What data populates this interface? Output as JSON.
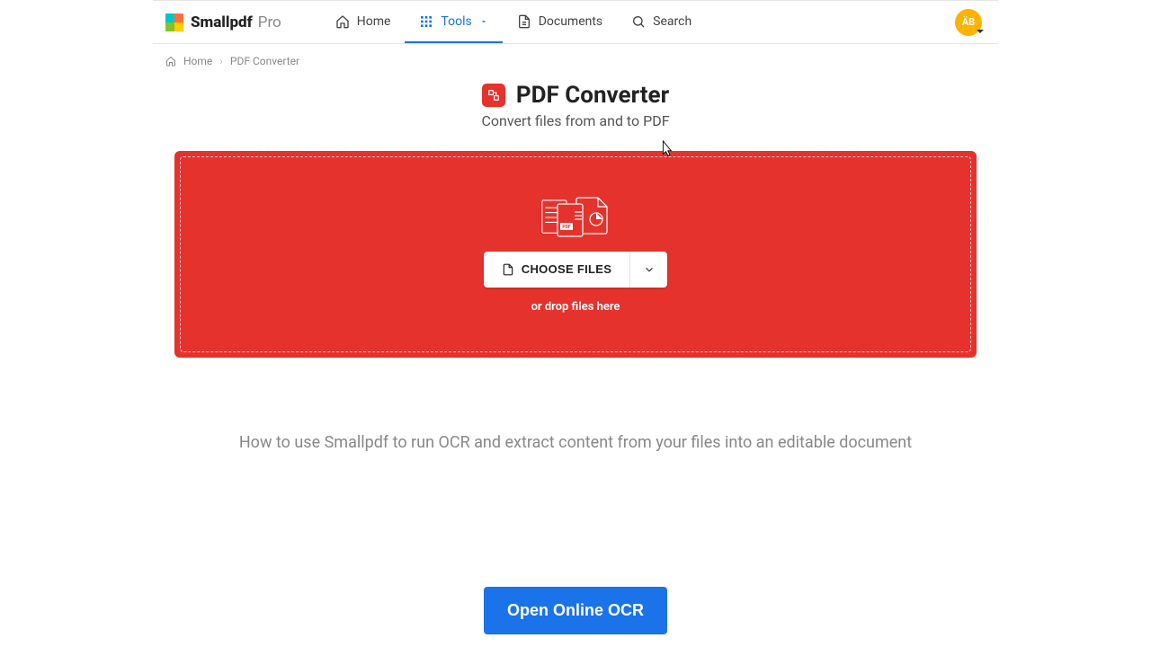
{
  "brand": {
    "name": "Smallpdf",
    "tier": "Pro"
  },
  "nav": {
    "home": "Home",
    "tools": "Tools",
    "documents": "Documents",
    "search": "Search"
  },
  "avatar": {
    "initials": "ÄB"
  },
  "breadcrumb": {
    "home": "Home",
    "current": "PDF Converter"
  },
  "page": {
    "title": "PDF Converter",
    "subtitle": "Convert files from and to PDF"
  },
  "dropzone": {
    "choose_label": "CHOOSE FILES",
    "hint": "or drop files here"
  },
  "howto": "How to use Smallpdf to run OCR and extract content from your files into an editable document",
  "cta": {
    "label": "Open Online OCR"
  },
  "colors": {
    "accent_red": "#e5322d",
    "accent_blue": "#1a73e8"
  }
}
